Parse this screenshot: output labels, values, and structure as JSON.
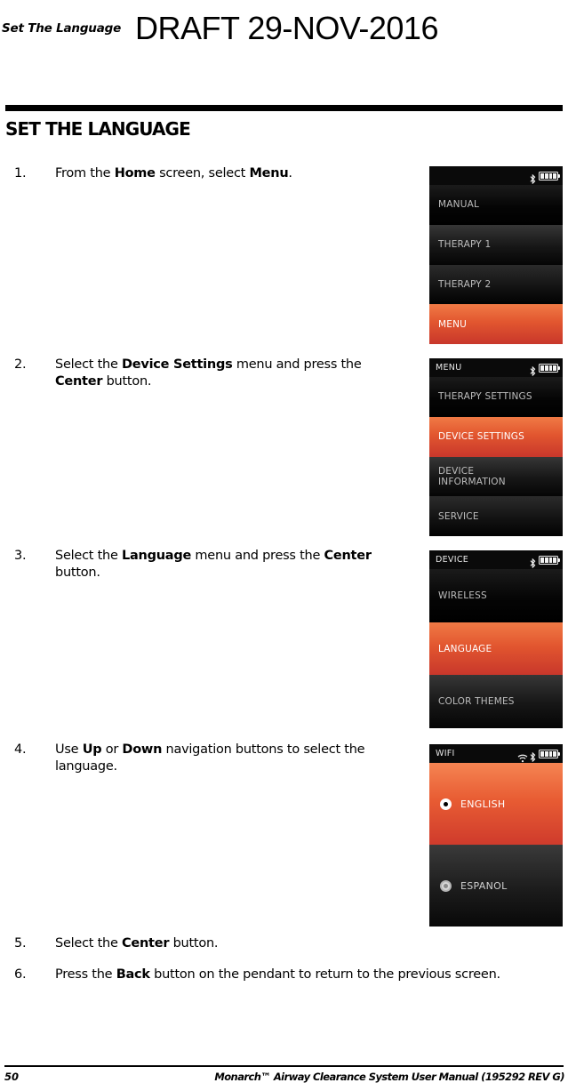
{
  "header": {
    "running_title": "Set The Language",
    "draft_stamp": "DRAFT  29-NOV-2016"
  },
  "section": {
    "title": "SET THE LANGUAGE"
  },
  "steps": [
    {
      "number": "1.",
      "parts": [
        {
          "text": "From the ",
          "bold": false
        },
        {
          "text": "Home",
          "bold": true
        },
        {
          "text": " screen, select ",
          "bold": false
        },
        {
          "text": "Menu",
          "bold": true
        },
        {
          "text": ".",
          "bold": false
        }
      ]
    },
    {
      "number": "2.",
      "parts": [
        {
          "text": "Select the ",
          "bold": false
        },
        {
          "text": "Device Settings",
          "bold": true
        },
        {
          "text": " menu and press the ",
          "bold": false
        },
        {
          "text": "Center",
          "bold": true
        },
        {
          "text": " button.",
          "bold": false
        }
      ]
    },
    {
      "number": "3.",
      "parts": [
        {
          "text": "Select the ",
          "bold": false
        },
        {
          "text": "Language",
          "bold": true
        },
        {
          "text": " menu and press the ",
          "bold": false
        },
        {
          "text": "Center",
          "bold": true
        },
        {
          "text": " button.",
          "bold": false
        }
      ]
    },
    {
      "number": "4.",
      "parts": [
        {
          "text": "Use ",
          "bold": false
        },
        {
          "text": "Up",
          "bold": true
        },
        {
          "text": " or ",
          "bold": false
        },
        {
          "text": "Down",
          "bold": true
        },
        {
          "text": " navigation buttons to select the  language.",
          "bold": false
        }
      ]
    },
    {
      "number": "5.",
      "parts": [
        {
          "text": "Select the ",
          "bold": false
        },
        {
          "text": "Center",
          "bold": true
        },
        {
          "text": " button.",
          "bold": false
        }
      ]
    },
    {
      "number": "6.",
      "parts": [
        {
          "text": "Press the ",
          "bold": false
        },
        {
          "text": "Back",
          "bold": true
        },
        {
          "text": " button on the pendant to return to the previous screen.",
          "bold": false
        }
      ]
    }
  ],
  "device_screens": [
    {
      "id": "screen-1",
      "status": {
        "title": "",
        "icons": [
          "bluetooth-icon",
          "battery-icon"
        ],
        "battery_bars": 4
      },
      "items": [
        {
          "label": "MANUAL",
          "selected": false
        },
        {
          "label": "THERAPY 1",
          "selected": false
        },
        {
          "label": "THERAPY 2",
          "selected": false
        },
        {
          "label": "MENU",
          "selected": true
        }
      ]
    },
    {
      "id": "screen-2",
      "status": {
        "title": "MENU",
        "icons": [
          "bluetooth-icon",
          "battery-icon"
        ],
        "battery_bars": 4
      },
      "items": [
        {
          "label": "THERAPY SETTINGS",
          "selected": false
        },
        {
          "label": "DEVICE SETTINGS",
          "selected": true
        },
        {
          "label": "DEVICE INFORMATION",
          "selected": false,
          "line1": "DEVICE",
          "line2": "INFORMATION"
        },
        {
          "label": "SERVICE",
          "selected": false
        }
      ]
    },
    {
      "id": "screen-3",
      "status": {
        "title": "DEVICE",
        "icons": [
          "bluetooth-icon",
          "battery-icon"
        ],
        "battery_bars": 4
      },
      "items": [
        {
          "label": "WIRELESS",
          "selected": false
        },
        {
          "label": "LANGUAGE",
          "selected": true
        },
        {
          "label": "COLOR THEMES",
          "selected": false
        }
      ]
    },
    {
      "id": "screen-4",
      "status": {
        "title": "WIFI",
        "icons": [
          "wifi-icon",
          "bluetooth-icon",
          "battery-icon"
        ],
        "battery_bars": 4
      },
      "options": [
        {
          "label": "ENGLISH",
          "selected": true
        },
        {
          "label": "ESPANOL",
          "selected": false
        }
      ]
    }
  ],
  "footer": {
    "page_number": "50",
    "manual_line": "Monarch™ Airway Clearance System User Manual (195292 REV G)"
  },
  "colors": {
    "highlight_orange_top": "#f07a45",
    "highlight_orange_bottom": "#c8372b",
    "screen_black": "#000000",
    "text_gray": "#bdbdbd"
  }
}
